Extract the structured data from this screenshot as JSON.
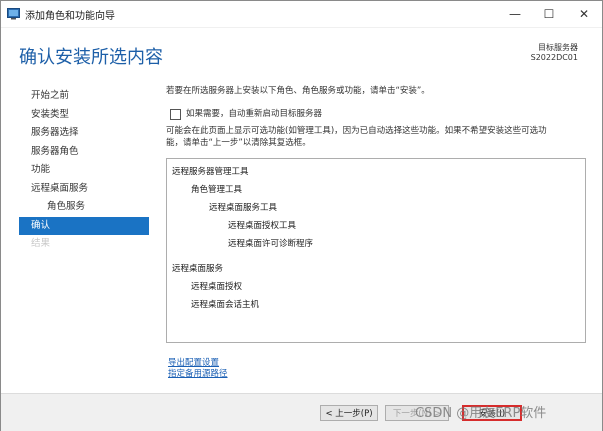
{
  "window": {
    "title": "添加角色和功能向导",
    "minimize": "—",
    "maximize": "☐",
    "close": "✕"
  },
  "header": {
    "title": "确认安装所选内容",
    "server_label": "目标服务器",
    "server_name": "S2022DC01"
  },
  "sidebar": {
    "items": [
      {
        "label": "开始之前",
        "state": "normal"
      },
      {
        "label": "安装类型",
        "state": "normal"
      },
      {
        "label": "服务器选择",
        "state": "normal"
      },
      {
        "label": "服务器角色",
        "state": "normal"
      },
      {
        "label": "功能",
        "state": "normal"
      },
      {
        "label": "远程桌面服务",
        "state": "normal"
      },
      {
        "label": "角色服务",
        "state": "sub"
      },
      {
        "label": "确认",
        "state": "active"
      },
      {
        "label": "结果",
        "state": "disabled"
      }
    ]
  },
  "main": {
    "instruction": "若要在所选服务器上安装以下角色、角色服务或功能，请单击“安装”。",
    "restart_checkbox_label": "如果需要，自动重新启动目标服务器",
    "restart_checked": false,
    "note_line1": "可能会在此页面上显示可选功能(如管理工具)，因为已自动选择这些功能。如果不希望安装这些可选功",
    "note_line2": "能，请单击“上一步”以清除其复选框。",
    "items": [
      "远程服务器管理工具",
      "角色管理工具",
      "远程桌面服务工具",
      "远程桌面授权工具",
      "远程桌面许可诊断程序",
      "远程桌面服务",
      "远程桌面授权",
      "远程桌面会话主机"
    ]
  },
  "links": {
    "export": "导出配置设置",
    "alt_source": "指定备用源路径"
  },
  "footer": {
    "prev": "< 上一步(P)",
    "next": "下一步(N) >",
    "install": "安装(I)"
  },
  "watermark": "CSDN @用友ERP软件",
  "colors": {
    "accent": "#1a73c4",
    "title_blue": "#1d5fa8",
    "highlight_red": "#d62c2c"
  }
}
